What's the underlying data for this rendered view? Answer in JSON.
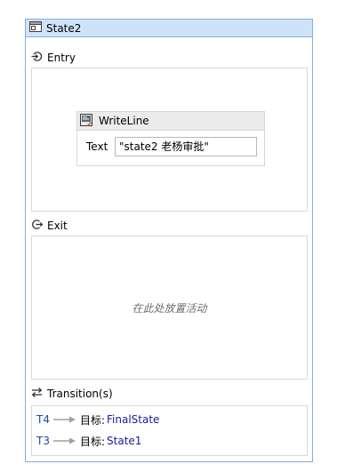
{
  "state": {
    "title": "State2"
  },
  "entry": {
    "label": "Entry",
    "activity": {
      "title": "WriteLine",
      "text_label": "Text",
      "text_value": "\"state2 老杨审批\""
    }
  },
  "exit": {
    "label": "Exit",
    "drop_hint": "在此处放置活动"
  },
  "transitions": {
    "label": "Transition(s)",
    "target_prefix": "目标:",
    "items": [
      {
        "name": "T4",
        "target": "FinalState"
      },
      {
        "name": "T3",
        "target": "State1"
      }
    ]
  },
  "colors": {
    "header_bg": "#cfe3f6",
    "border": "#84aeda",
    "transition_name": "#1a4aa6",
    "transition_target": "#1a1aa0"
  }
}
